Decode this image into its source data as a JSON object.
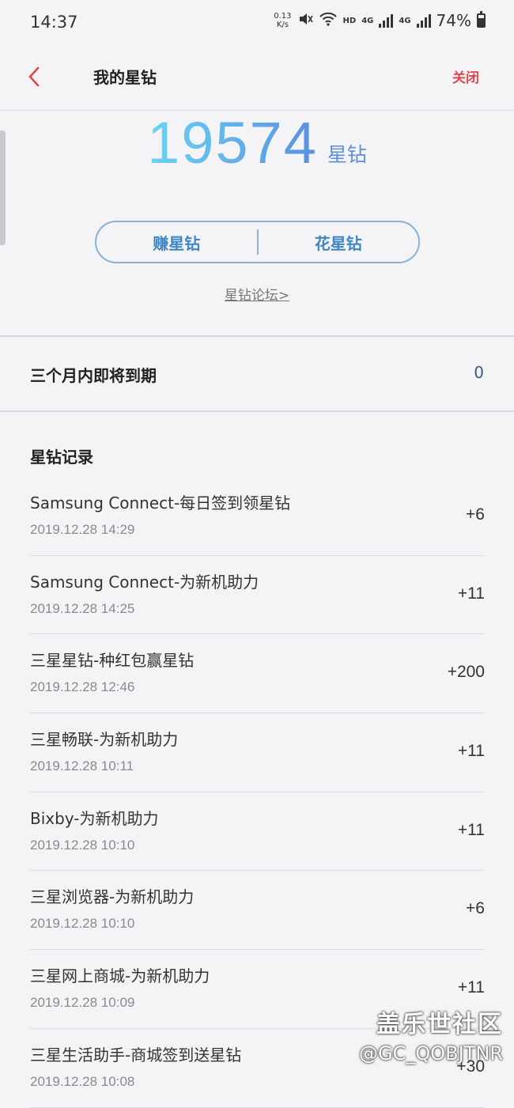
{
  "status_bar": {
    "time": "14:37",
    "net_speed_value": "0.13",
    "net_speed_unit": "K/s",
    "hd_label": "HD",
    "net_type_1": "4G",
    "net_type_2": "4G",
    "battery_percent": "74%"
  },
  "header": {
    "title": "我的星钻",
    "close_label": "关闭"
  },
  "balance": {
    "value": "19574",
    "unit": "星钻"
  },
  "actions": {
    "earn_label": "赚星钻",
    "spend_label": "花星钻",
    "forum_link": "星钻论坛>"
  },
  "expiring": {
    "label": "三个月内即将到期",
    "count": "0"
  },
  "records": {
    "title": "星钻记录",
    "items": [
      {
        "name": "Samsung Connect-每日签到领星钻",
        "time": "2019.12.28 14:29",
        "amount": "+6"
      },
      {
        "name": "Samsung Connect-为新机助力",
        "time": "2019.12.28 14:25",
        "amount": "+11"
      },
      {
        "name": "三星星钻-种红包赢星钻",
        "time": "2019.12.28 12:46",
        "amount": "+200"
      },
      {
        "name": "三星畅联-为新机助力",
        "time": "2019.12.28 10:11",
        "amount": "+11"
      },
      {
        "name": "Bixby-为新机助力",
        "time": "2019.12.28 10:10",
        "amount": "+11"
      },
      {
        "name": "三星浏览器-为新机助力",
        "time": "2019.12.28 10:10",
        "amount": "+6"
      },
      {
        "name": "三星网上商城-为新机助力",
        "time": "2019.12.28 10:09",
        "amount": "+11"
      },
      {
        "name": "三星生活助手-商城签到送星钻",
        "time": "2019.12.28 10:08",
        "amount": "+30"
      }
    ]
  },
  "watermark": {
    "title": "盖乐世社区",
    "user": "@GC_QOBJTNR"
  }
}
